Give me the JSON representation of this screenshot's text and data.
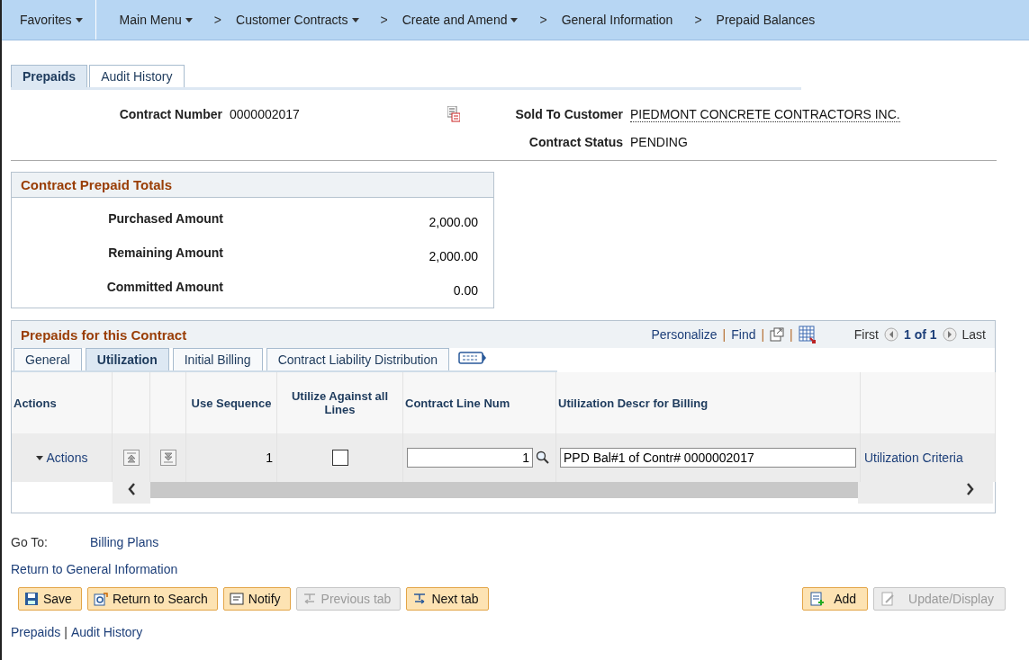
{
  "nav": [
    {
      "label": "Favorites",
      "dropdown": true
    },
    {
      "label": "Main Menu",
      "dropdown": true
    },
    {
      "prefix": ">",
      "label": "Customer Contracts",
      "dropdown": true
    },
    {
      "prefix": ">",
      "label": "Create and Amend",
      "dropdown": true
    },
    {
      "prefix": ">",
      "label": "General Information",
      "dropdown": false
    },
    {
      "prefix": ">",
      "label": "Prepaid Balances",
      "dropdown": false
    }
  ],
  "page_tabs": [
    {
      "label": "Prepaids",
      "selected": true
    },
    {
      "label": "Audit History",
      "selected": false
    }
  ],
  "header": {
    "contract_number_label": "Contract Number",
    "contract_number": "0000002017",
    "sold_to_label": "Sold To Customer",
    "sold_to": "PIEDMONT CONCRETE CONTRACTORS INC.",
    "status_label": "Contract Status",
    "status": "PENDING"
  },
  "totals": {
    "title": "Contract Prepaid Totals",
    "rows": [
      {
        "label": "Purchased Amount",
        "value": "2,000.00"
      },
      {
        "label": "Remaining Amount",
        "value": "2,000.00"
      },
      {
        "label": "Committed Amount",
        "value": "0.00"
      }
    ]
  },
  "grid": {
    "title": "Prepaids for this Contract",
    "personalize": "Personalize",
    "find": "Find",
    "separators": [
      "|",
      "|",
      "|"
    ],
    "first": "First",
    "count": "1 of 1",
    "last": "Last",
    "tabs": [
      {
        "label": "General",
        "selected": false
      },
      {
        "label": "Utilization",
        "selected": true
      },
      {
        "label": "Initial Billing",
        "selected": false
      },
      {
        "label": "Contract Liability Distribution",
        "selected": false
      }
    ],
    "columns": [
      "Actions",
      "Use Sequence",
      "Utilize Against all Lines",
      "Contract Line Num",
      "Utilization Descr for Billing"
    ],
    "rows": [
      {
        "actions": "Actions",
        "use_sequence": "1",
        "utilize_all": false,
        "line_num": "1",
        "descr": "PPD Bal#1 of Contr# 0000002017",
        "link": "Utilization Criteria"
      }
    ]
  },
  "goto": {
    "label": "Go To:",
    "link": "Billing Plans"
  },
  "return_link": "Return to General Information",
  "buttons": [
    {
      "label": "Save",
      "disabled": false,
      "kind": "save"
    },
    {
      "label": "Return to Search",
      "disabled": false,
      "kind": "search"
    },
    {
      "label": "Notify",
      "disabled": false,
      "kind": "notify"
    },
    {
      "label": "Previous tab",
      "disabled": true,
      "kind": "prev"
    },
    {
      "label": "Next tab",
      "disabled": false,
      "kind": "next"
    }
  ],
  "right_buttons": [
    {
      "label": "Add",
      "disabled": false,
      "kind": "add"
    },
    {
      "label": "Update/Display",
      "disabled": true,
      "kind": "update"
    }
  ],
  "footer": {
    "links": [
      "Prepaids",
      "Audit History"
    ],
    "separators": [
      "|"
    ]
  }
}
